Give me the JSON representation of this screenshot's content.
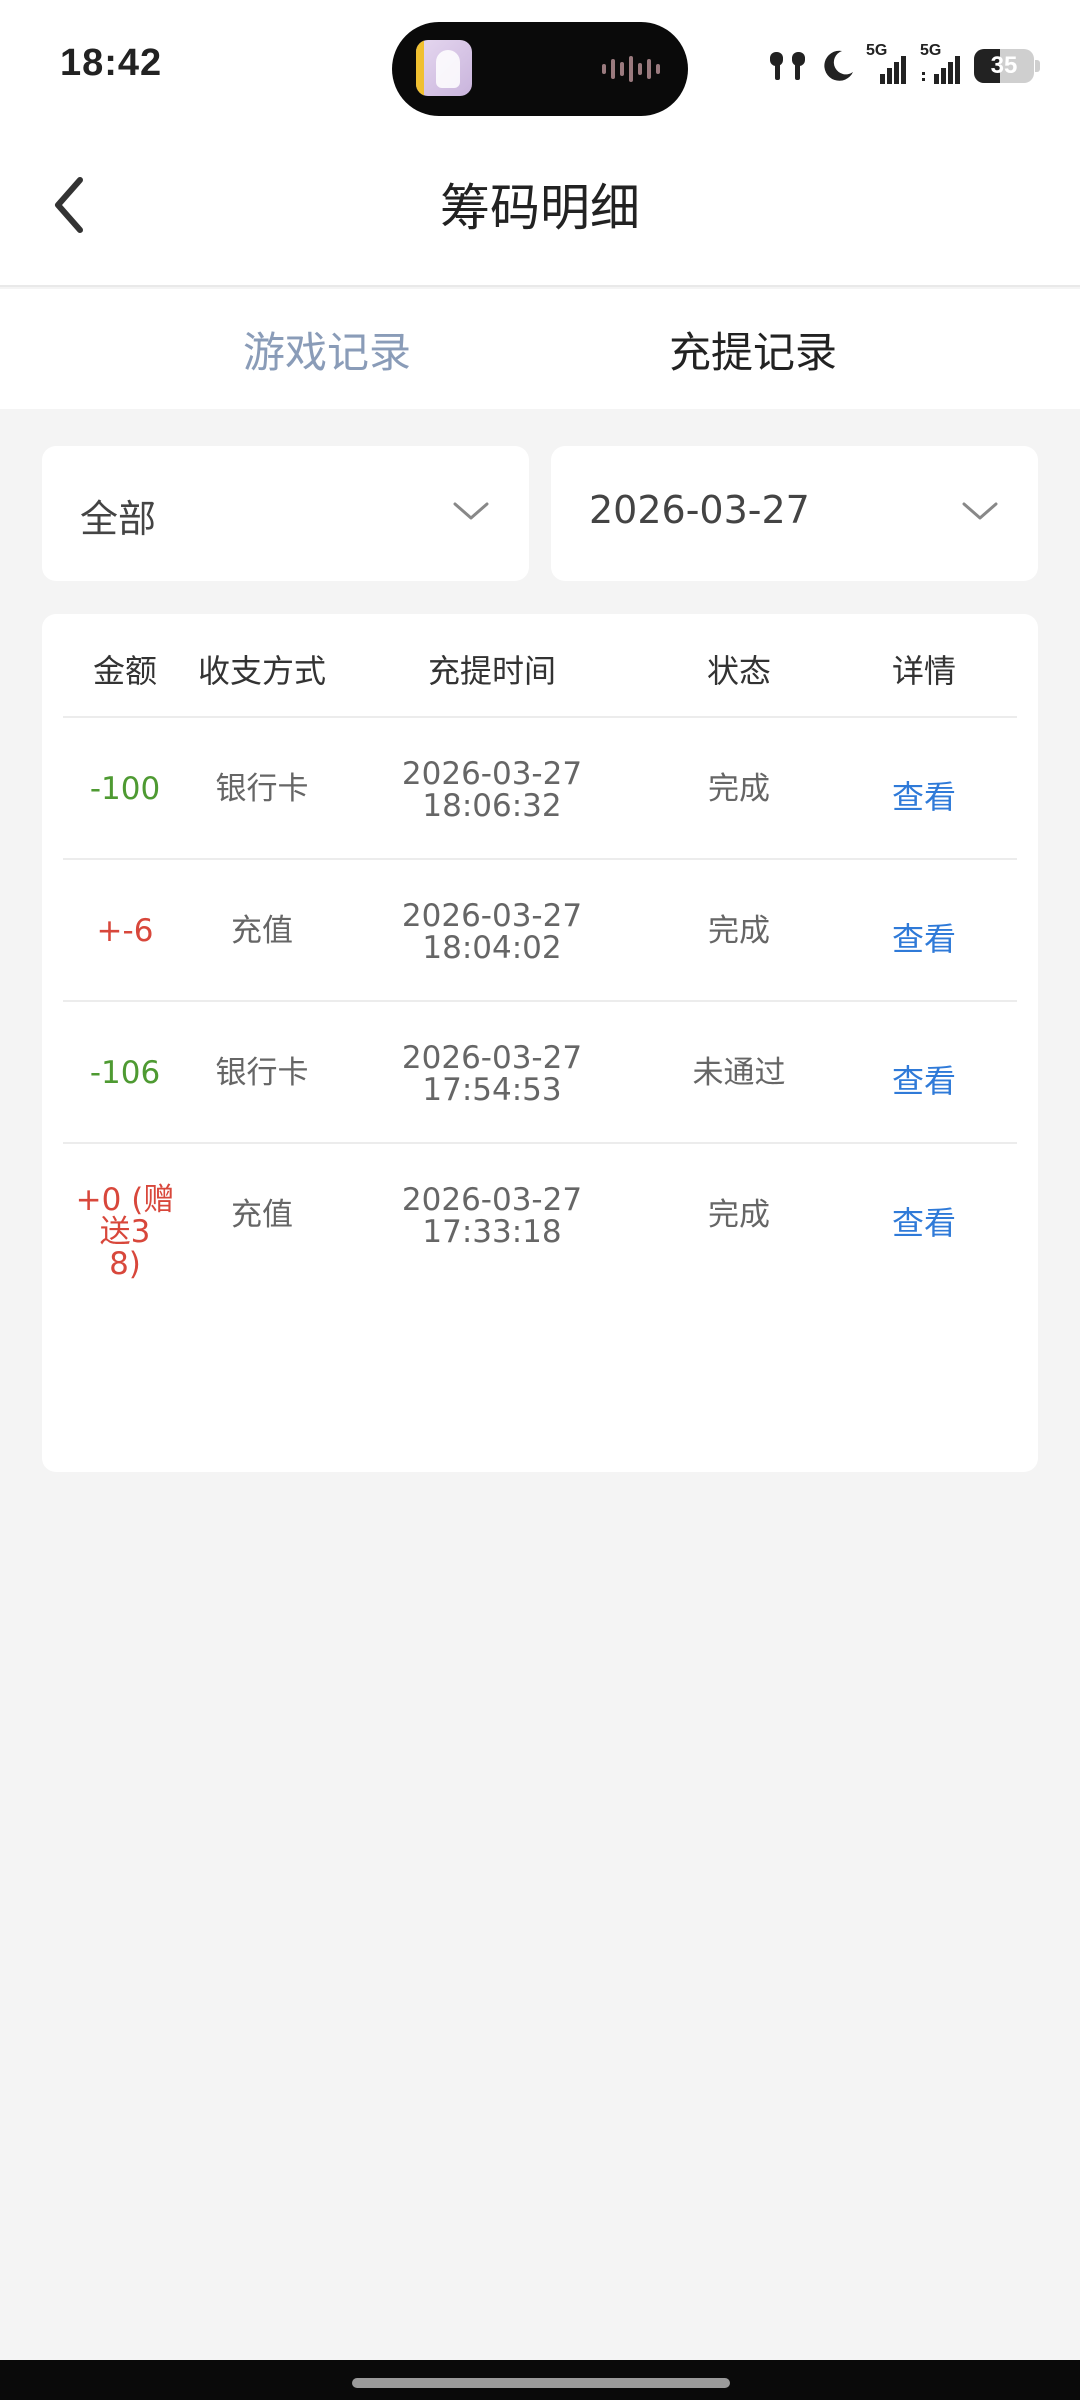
{
  "status_bar": {
    "time": "18:42",
    "network1": "5G",
    "network2": "5G",
    "battery": "35",
    "icons": [
      "earbuds-icon",
      "moon-icon",
      "signal-icon",
      "signal-icon",
      "battery-icon"
    ]
  },
  "header": {
    "title": "筹码明细"
  },
  "tabs": [
    {
      "label": "游戏记录",
      "active": false
    },
    {
      "label": "充提记录",
      "active": true
    }
  ],
  "filters": {
    "type_value": "全部",
    "date_value": "2026-03-27"
  },
  "table": {
    "headers": [
      "金额",
      "收支方式",
      "充提时间",
      "状态",
      "详情"
    ],
    "rows": [
      {
        "amount": "-100",
        "method": "银行卡",
        "date": "2026-03-27",
        "time": "18:06:32",
        "status": "完成",
        "detail": "查看",
        "sign": "neg"
      },
      {
        "amount": "+-6",
        "method": "充值",
        "date": "2026-03-27",
        "time": "18:04:02",
        "status": "完成",
        "detail": "查看",
        "sign": "pos"
      },
      {
        "amount": "-106",
        "method": "银行卡",
        "date": "2026-03-27",
        "time": "17:54:53",
        "status": "未通过",
        "detail": "查看",
        "sign": "neg"
      },
      {
        "amount_line1": "+0 (赠送3",
        "amount_line2": "8)",
        "method": "充值",
        "date": "2026-03-27",
        "time": "17:33:18",
        "status": "完成",
        "detail": "查看",
        "sign": "pos"
      }
    ]
  },
  "colors": {
    "negative": "#4e9a32",
    "positive": "#d8473b",
    "link": "#2f7ad8",
    "inactive_tab": "#8a9cb8"
  }
}
